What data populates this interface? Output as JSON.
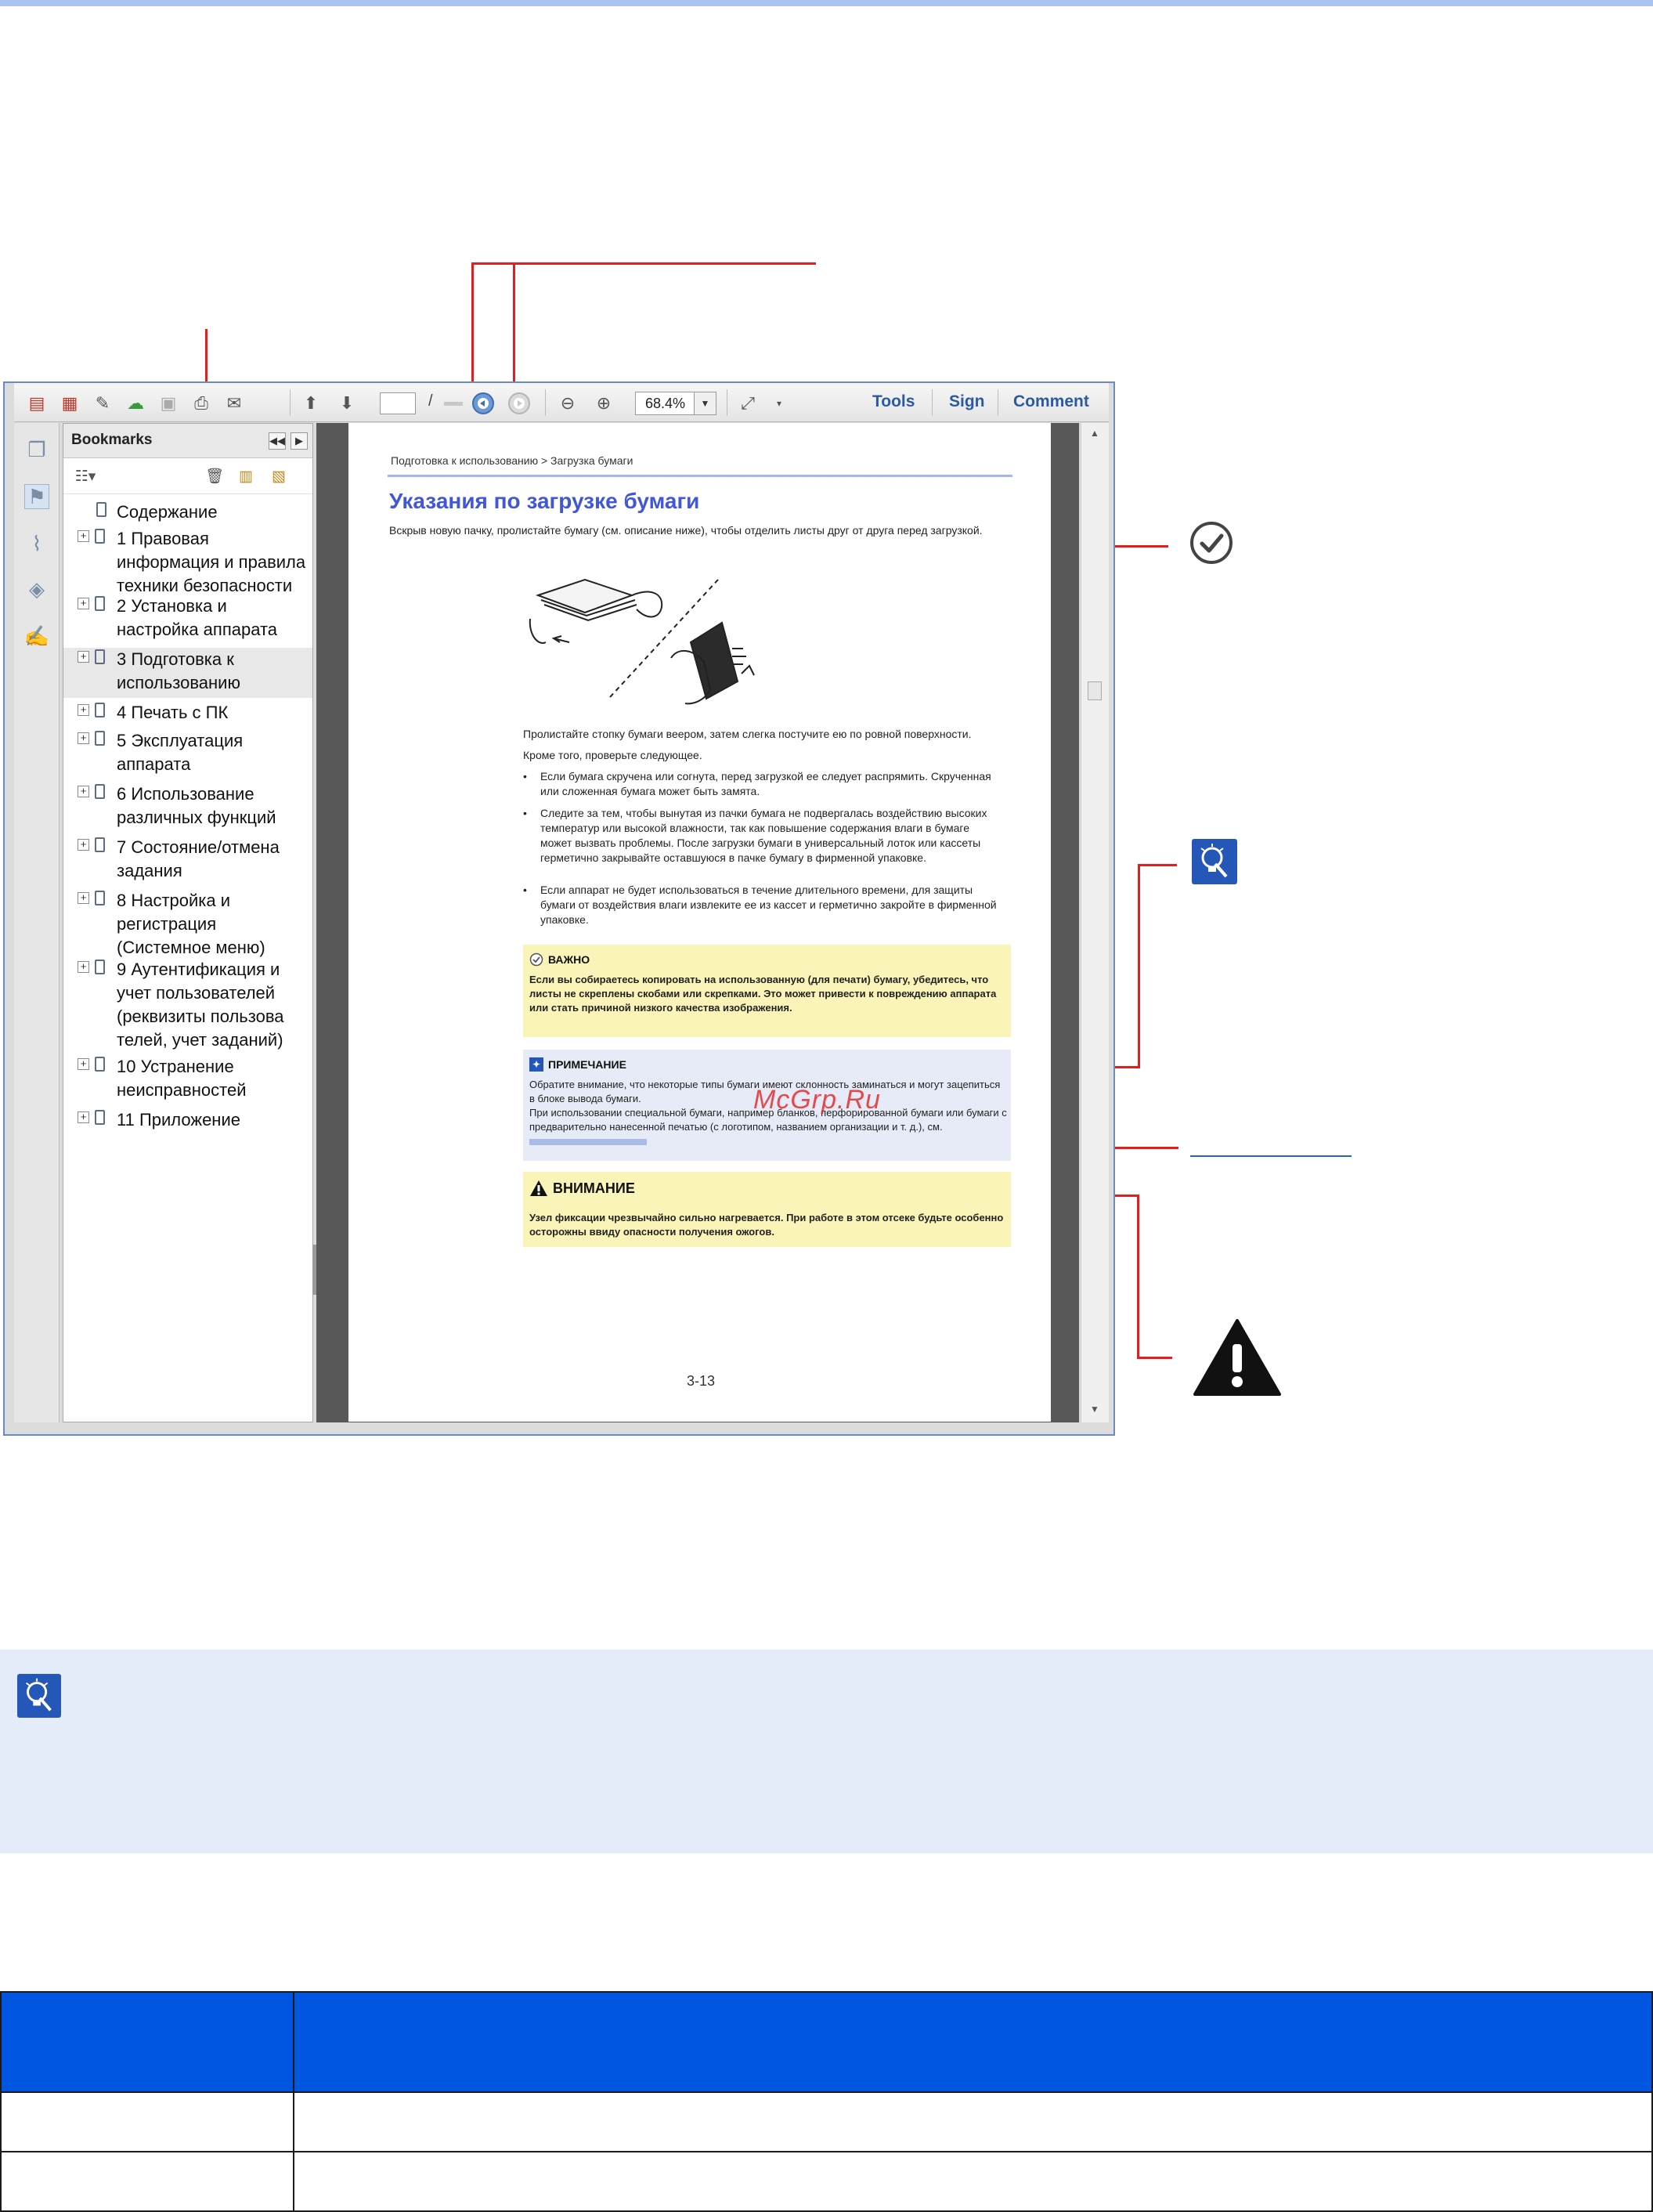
{
  "toolbar": {
    "zoom": "68.4%",
    "page_separator": "/",
    "tools_label": "Tools",
    "sign_label": "Sign",
    "comment_label": "Comment"
  },
  "bookmarks": {
    "title": "Bookmarks",
    "items": [
      {
        "label": "Содержание",
        "expandable": false
      },
      {
        "label": "1 Правовая\nинформация и правила\nтехники безопасности",
        "expandable": true
      },
      {
        "label": "2 Установка и\nнастройка аппарата",
        "expandable": true
      },
      {
        "label": "3 Подготовка к\nиспользованию",
        "expandable": true,
        "selected": true
      },
      {
        "label": "4 Печать с ПК",
        "expandable": true
      },
      {
        "label": "5 Эксплуатация\nаппарата",
        "expandable": true
      },
      {
        "label": "6 Использование\nразличных функций",
        "expandable": true
      },
      {
        "label": "7 Состояние/отмена\nзадания",
        "expandable": true
      },
      {
        "label": "8 Настройка и\nрегистрация\n(Системное меню)",
        "expandable": true
      },
      {
        "label": "9 Аутентификация и\nучет пользователей\n(реквизиты пользова\nтелей, учет заданий)",
        "expandable": true
      },
      {
        "label": "10 Устранение\nнеисправностей",
        "expandable": true
      },
      {
        "label": "11 Приложение",
        "expandable": true
      }
    ]
  },
  "page": {
    "breadcrumb": "Подготовка к использованию > Загрузка бумаги",
    "title": "Указания по загрузке бумаги",
    "intro": "Вскрыв новую пачку, пролистайте бумагу (см. описание ниже), чтобы отделить листы друг от друга перед загрузкой.",
    "fan_text": "Пролистайте стопку бумаги веером, затем слегка постучите ею по ровной поверхности.",
    "check_text": "Кроме того, проверьте следующее.",
    "bullets": [
      "Если бумага скручена или согнута, перед загрузкой ее следует распрямить. Скрученная или сложенная бумага может быть замята.",
      "Следите за тем, чтобы вынутая из пачки бумага не подвергалась воздействию высоких температур или высокой влажности, так как повышение содержания влаги в бумаге\nможет вызвать проблемы. После загрузки бумаги в универсальный лоток или кассеты герметично закрывайте оставшуюся в пачке бумагу в фирменной упаковке.",
      "Если аппарат не будет использоваться в течение длительного времени, для защиты бумаги от воздействия влаги извлеките ее из кассет и герметично закройте в фирменной упаковке."
    ],
    "important_head": "ВАЖНО",
    "important_body": "Если вы собираетесь копировать на использованную (для печати) бумагу, убедитесь, что листы не скреплены скобами или скрепками. Это может привести к повреждению аппарата или стать причиной низкого качества изображения.",
    "note_head": "ПРИМЕЧАНИЕ",
    "note_body_1": "Обратите внимание, что некоторые типы бумаги имеют склонность заминаться и могут зацепиться в блоке вывода бумаги.",
    "note_body_2": "При использовании специальной бумаги, например бланков, перфорированной бумаги или бумаги с предварительно нанесенной печатью (с логотипом, названием организации и т. д.), см.",
    "warn_head": "ВНИМАНИЕ",
    "warn_body": "Узел фиксации чрезвычайно сильно нагревается. При работе в этом отсеке будьте особенно осторожны ввиду опасности получения ожогов.",
    "page_number": "3-13",
    "watermark": "McGrp.Ru"
  },
  "colors": {
    "callout": "#e41e1e",
    "table_header": "#0056e0",
    "note_band": "#e5ecf9",
    "title_blue": "#4057d7"
  }
}
